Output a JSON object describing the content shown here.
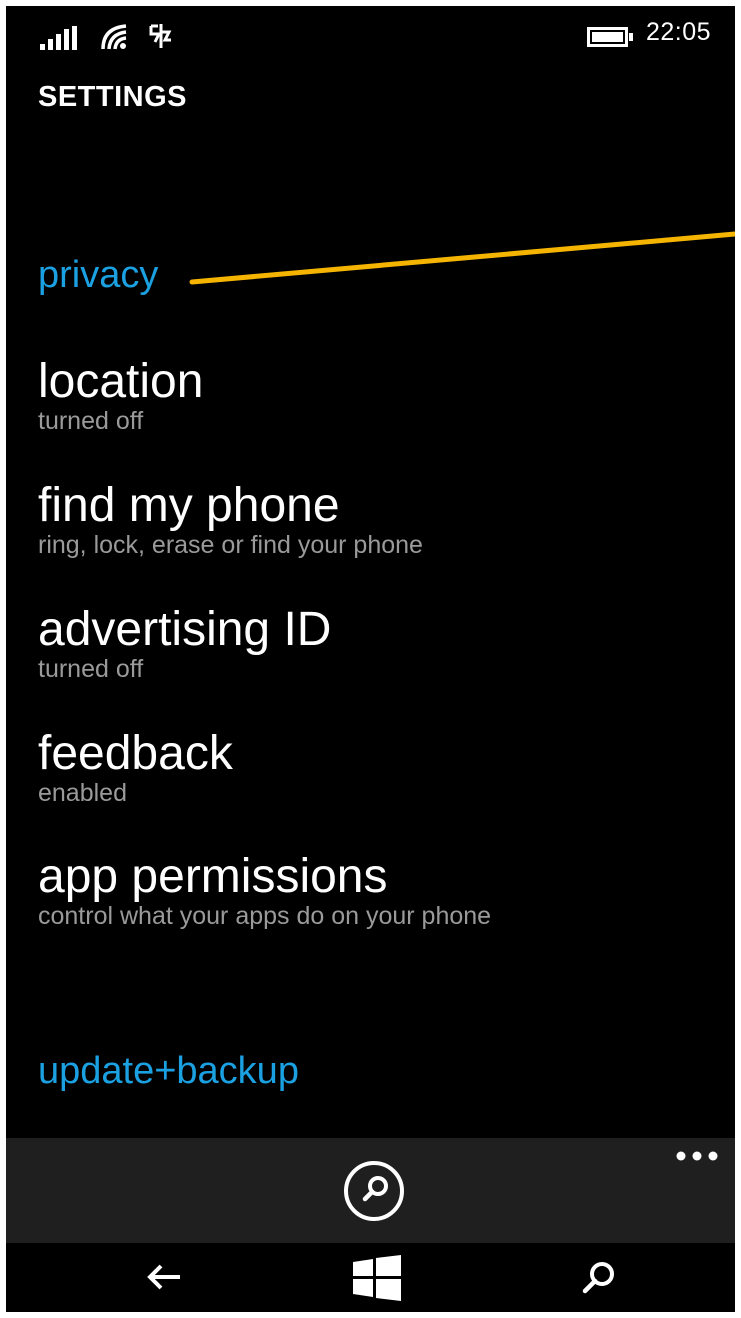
{
  "status": {
    "time": "22:05"
  },
  "header": {
    "title": "SETTINGS"
  },
  "sections": {
    "privacy": "privacy",
    "update": "update+backup"
  },
  "items": [
    {
      "title": "location",
      "sub": "turned off"
    },
    {
      "title": "find my phone",
      "sub": "ring, lock, erase or find your phone"
    },
    {
      "title": "advertising ID",
      "sub": "turned off"
    },
    {
      "title": "feedback",
      "sub": "enabled"
    },
    {
      "title": "app permissions",
      "sub": "control what your apps do on your phone"
    }
  ],
  "icons": {
    "signal": "signal-strength-icon",
    "wifi": "wifi-icon",
    "data_sense": "data-sense-icon",
    "battery": "battery-icon",
    "appbar_search": "search-icon",
    "more": "more-ellipsis-icon",
    "back": "back-arrow-icon",
    "start": "windows-logo-icon",
    "nav_search": "search-icon"
  },
  "colors": {
    "accent": "#1ba1e2",
    "background": "#000000",
    "appbar": "#1f1f1f",
    "annotation": "#f5b400"
  }
}
